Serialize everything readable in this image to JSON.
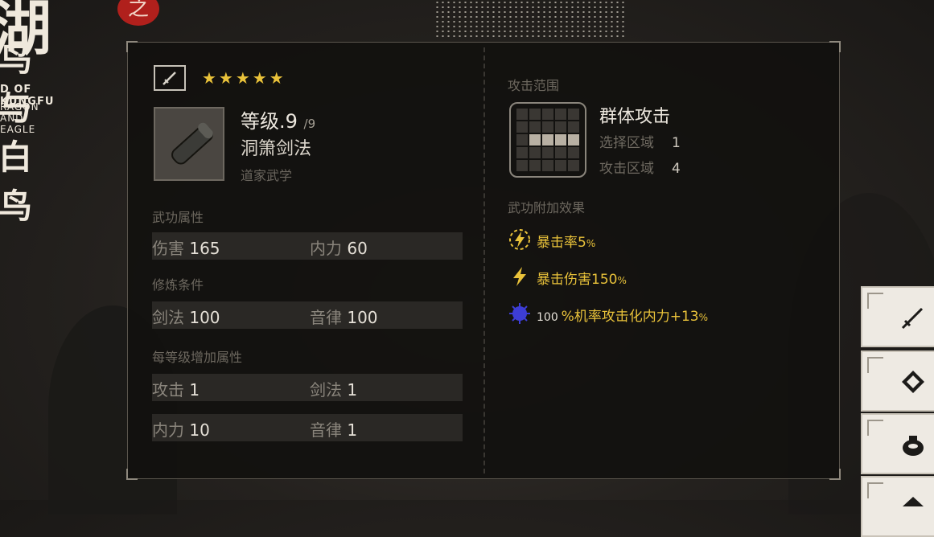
{
  "logo": {
    "big": "湖",
    "seal": "之",
    "sub": "鸟与白鸟",
    "en_line1": "D OF KUNGFU",
    "en_line2": "RAGON AND EAGLE"
  },
  "skill": {
    "type_icon": "sword-icon",
    "stars": "★★★★★",
    "star_count": 5,
    "level_label": "等级",
    "level_value": ".9",
    "level_max": "/9",
    "name": "洞箫剑法",
    "school": "道家武学"
  },
  "sections": {
    "attributes_title": "武功属性",
    "requirements_title": "修炼条件",
    "per_level_title": "每等级增加属性"
  },
  "attributes": [
    {
      "label": "伤害",
      "value": "165"
    },
    {
      "label": "内力",
      "value": "60"
    }
  ],
  "requirements": [
    {
      "label": "剑法",
      "value": "100"
    },
    {
      "label": "音律",
      "value": "100"
    }
  ],
  "per_level": [
    [
      {
        "label": "攻击",
        "value": "1"
      },
      {
        "label": "剑法",
        "value": "1"
      }
    ],
    [
      {
        "label": "内力",
        "value": "10"
      },
      {
        "label": "音律",
        "value": "1"
      }
    ]
  ],
  "range": {
    "title": "攻击范围",
    "name": "群体攻击",
    "select_label": "选择区域",
    "select_value": "1",
    "attack_label": "攻击区域",
    "attack_value": "4"
  },
  "effects": {
    "title": "武功附加效果",
    "items": [
      {
        "icon": "lightning-circle-icon",
        "text": "暴击率5",
        "suffix": "%"
      },
      {
        "icon": "lightning-icon",
        "text": "暴击伤害150",
        "suffix": "%"
      },
      {
        "icon": "blue-orb-icon",
        "prefix": "100",
        "text": "%机率攻击化内力+13",
        "suffix": "%"
      }
    ]
  },
  "side_buttons": [
    {
      "icon": "sword-icon"
    },
    {
      "icon": "book-icon"
    },
    {
      "icon": "pouch-icon"
    },
    {
      "icon": "gem-icon"
    }
  ],
  "colors": {
    "gold": "#e9c23a",
    "panel_bg": "#12110f",
    "text_main": "#e6e1d8"
  }
}
